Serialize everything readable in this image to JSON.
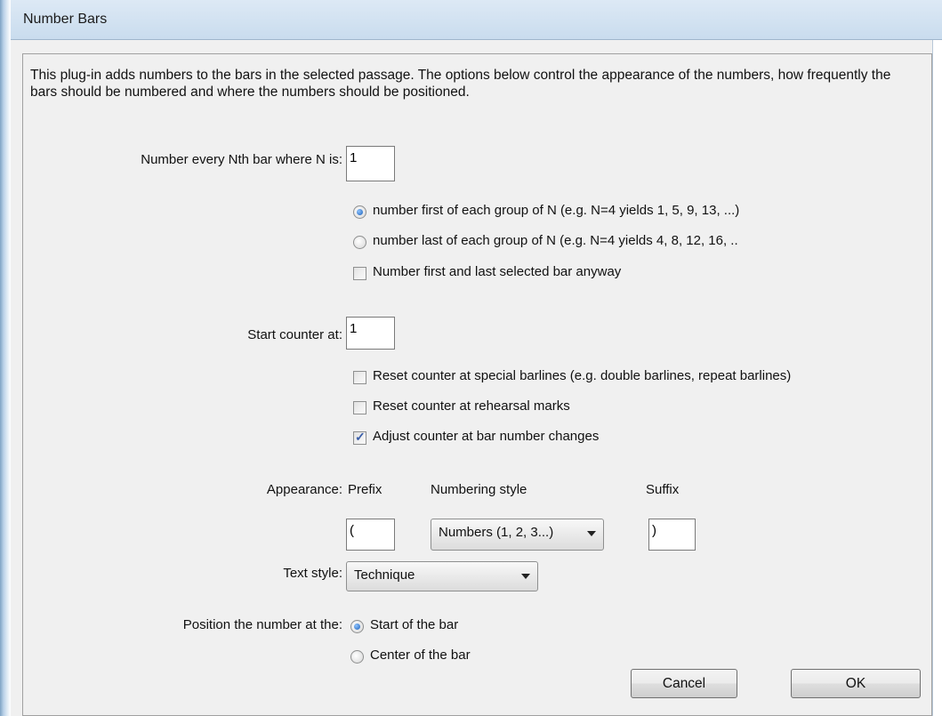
{
  "window": {
    "title": "Number Bars"
  },
  "description": "This plug-in adds numbers to the bars in the selected passage. The options below control the appearance of the numbers, how frequently the bars should be numbered and where the numbers should be positioned.",
  "nth_bar": {
    "label": "Number every Nth bar where N is:",
    "value": "1",
    "options": [
      {
        "label": "number first of each group of N (e.g. N=4 yields 1, 5, 9, 13, ...)",
        "selected": true
      },
      {
        "label": "number last of each group of N (e.g. N=4 yields 4, 8, 12, 16, ..",
        "selected": false
      }
    ],
    "first_last_checkbox": {
      "label": "Number first and last selected bar anyway",
      "checked": false
    }
  },
  "counter": {
    "label": "Start counter at:",
    "value": "1",
    "checkboxes": [
      {
        "label": "Reset counter at special barlines (e.g. double barlines, repeat barlines)",
        "checked": false
      },
      {
        "label": "Reset counter at rehearsal marks",
        "checked": false
      },
      {
        "label": "Adjust counter at bar number changes",
        "checked": true
      }
    ]
  },
  "appearance": {
    "label": "Appearance:",
    "prefix_label": "Prefix",
    "prefix_value": "(",
    "style_label": "Numbering style",
    "style_value": "Numbers (1, 2, 3...)",
    "suffix_label": "Suffix",
    "suffix_value": ")"
  },
  "text_style": {
    "label": "Text style:",
    "value": "Technique"
  },
  "position": {
    "label": "Position the number at the:",
    "options": [
      {
        "label": "Start of the bar",
        "selected": true
      },
      {
        "label": "Center of the bar",
        "selected": false
      }
    ]
  },
  "buttons": {
    "cancel": "Cancel",
    "ok": "OK"
  }
}
